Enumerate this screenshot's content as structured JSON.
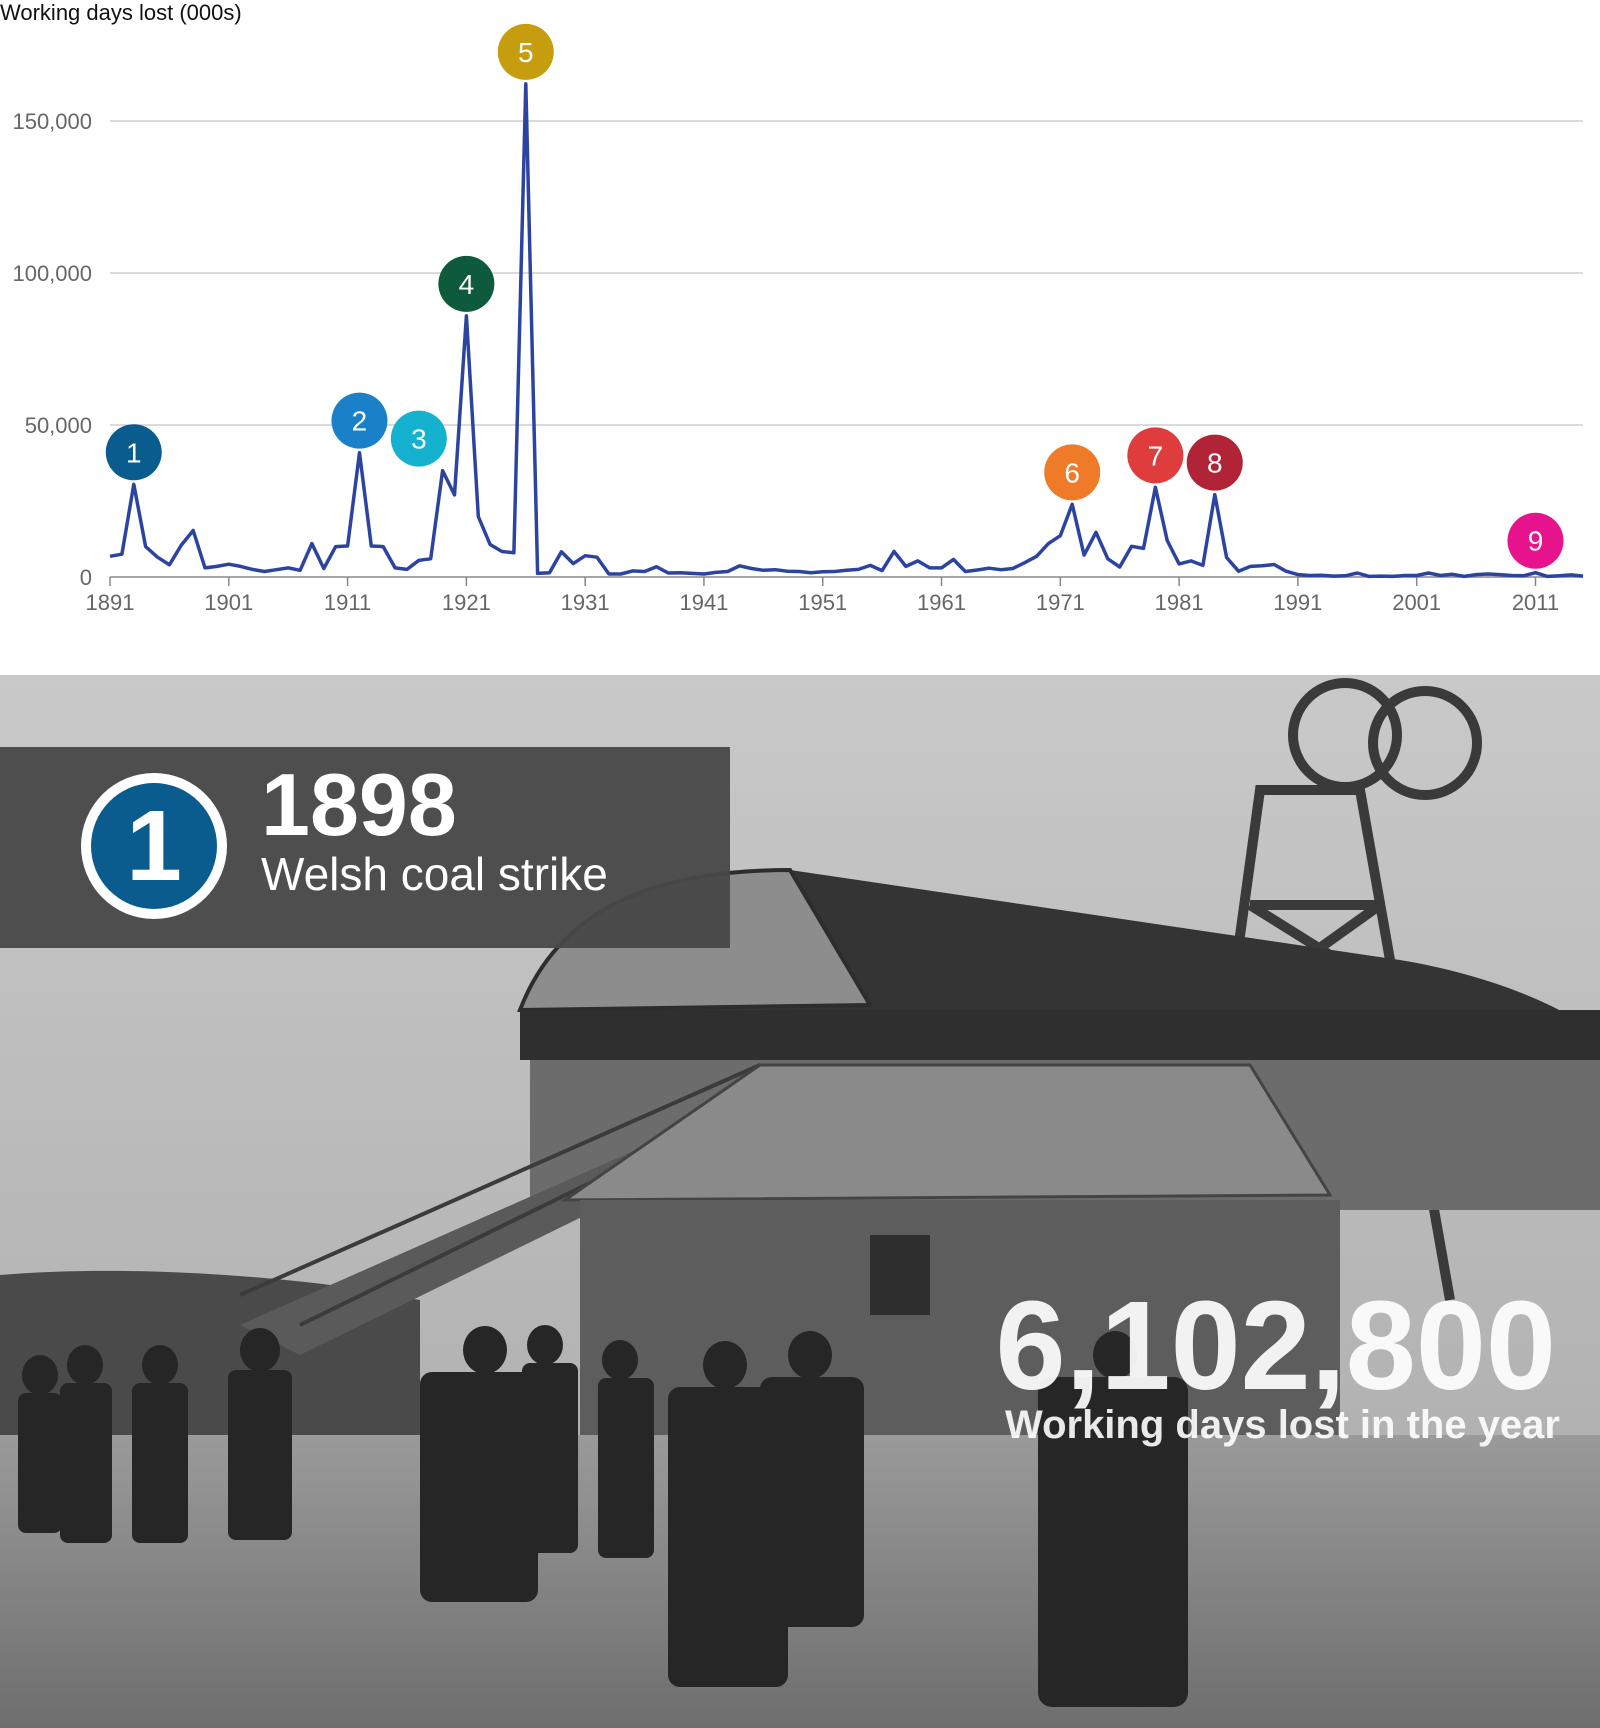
{
  "chart_data": {
    "type": "line",
    "title": "",
    "ylabel": "Working days lost (000s)",
    "xlabel": "",
    "ylim": [
      0,
      175000
    ],
    "xlim": [
      1891,
      2015
    ],
    "yticks": [
      0,
      50000,
      100000,
      150000
    ],
    "ytick_labels": [
      "0",
      "50,000",
      "100,000",
      "150,000"
    ],
    "xticks": [
      1891,
      1901,
      1911,
      1921,
      1931,
      1941,
      1951,
      1961,
      1971,
      1981,
      1991,
      2001,
      2011
    ],
    "xtick_labels": [
      "1891",
      "1901",
      "1911",
      "1921",
      "1931",
      "1941",
      "1951",
      "1961",
      "1971",
      "1981",
      "1991",
      "2001",
      "2011"
    ],
    "grid": "horizontal",
    "line_color": "#2c44a0",
    "x": [
      1891,
      1892,
      1893,
      1894,
      1895,
      1896,
      1897,
      1898,
      1899,
      1900,
      1901,
      1902,
      1903,
      1904,
      1905,
      1906,
      1907,
      1908,
      1909,
      1910,
      1911,
      1912,
      1913,
      1914,
      1915,
      1916,
      1917,
      1918,
      1919,
      1920,
      1921,
      1922,
      1923,
      1924,
      1925,
      1926,
      1927,
      1928,
      1929,
      1930,
      1931,
      1932,
      1933,
      1934,
      1935,
      1936,
      1937,
      1938,
      1939,
      1940,
      1941,
      1942,
      1943,
      1944,
      1945,
      1946,
      1947,
      1948,
      1949,
      1950,
      1951,
      1952,
      1953,
      1954,
      1955,
      1956,
      1957,
      1958,
      1959,
      1960,
      1961,
      1962,
      1963,
      1964,
      1965,
      1966,
      1967,
      1968,
      1969,
      1970,
      1971,
      1972,
      1973,
      1974,
      1975,
      1976,
      1977,
      1978,
      1979,
      1980,
      1981,
      1982,
      1983,
      1984,
      1985,
      1986,
      1987,
      1988,
      1989,
      1990,
      1991,
      1992,
      1993,
      1994,
      1995,
      1996,
      1997,
      1998,
      1999,
      2000,
      2001,
      2002,
      2003,
      2004,
      2005,
      2006,
      2007,
      2008,
      2009,
      2010,
      2011,
      2012,
      2013,
      2014,
      2015
    ],
    "values": [
      6800,
      7500,
      30500,
      10000,
      6500,
      4000,
      10500,
      15300,
      3000,
      3500,
      4200,
      3500,
      2500,
      1800,
      2400,
      3000,
      2200,
      11000,
      2800,
      10000,
      10200,
      40900,
      10200,
      10000,
      3000,
      2500,
      5500,
      6000,
      35000,
      27000,
      85900,
      19900,
      10700,
      8400,
      8000,
      162200,
      1200,
      1400,
      8300,
      4400,
      7000,
      6500,
      1000,
      1000,
      2000,
      1800,
      3400,
      1300,
      1400,
      1200,
      1000,
      1500,
      1800,
      3700,
      2800,
      2200,
      2400,
      1900,
      1800,
      1400,
      1700,
      1800,
      2200,
      2500,
      3800,
      2100,
      8400,
      3500,
      5300,
      3000,
      3000,
      5800,
      1800,
      2300,
      2900,
      2400,
      2800,
      4700,
      6800,
      11000,
      13600,
      23900,
      7200,
      14700,
      6000,
      3300,
      10100,
      9400,
      29500,
      12000,
      4300,
      5300,
      3800,
      27100,
      6400,
      1900,
      3500,
      3700,
      4100,
      1900,
      800,
      500,
      600,
      300,
      400,
      1300,
      200,
      300,
      200,
      500,
      500,
      1300,
      500,
      900,
      200,
      800,
      1000,
      800,
      500,
      400,
      1400,
      200,
      400,
      700,
      300
    ],
    "annotations": [
      {
        "label": "1",
        "x": 1893,
        "y": 30500,
        "color": "#0a5c8f"
      },
      {
        "label": "2",
        "x": 1912,
        "y": 40900,
        "color": "#1a80c8"
      },
      {
        "label": "3",
        "x": 1917,
        "y": 35000,
        "color": "#15b2cf"
      },
      {
        "label": "4",
        "x": 1921,
        "y": 85900,
        "color": "#0d5a3c"
      },
      {
        "label": "5",
        "x": 1926,
        "y": 162200,
        "color": "#c59d0e"
      },
      {
        "label": "6",
        "x": 1972,
        "y": 23900,
        "color": "#ef7a27"
      },
      {
        "label": "7",
        "x": 1979,
        "y": 29500,
        "color": "#df3d3d"
      },
      {
        "label": "8",
        "x": 1984,
        "y": 27100,
        "color": "#b12438"
      },
      {
        "label": "9",
        "x": 2011,
        "y": 1400,
        "color": "#e6138c"
      }
    ]
  },
  "event_card": {
    "number": "1",
    "year": "1898",
    "title": "Welsh coal strike",
    "badge_color": "#0a5c8f"
  },
  "stat": {
    "value": "6,102,800",
    "label": "Working days lost in the year"
  }
}
